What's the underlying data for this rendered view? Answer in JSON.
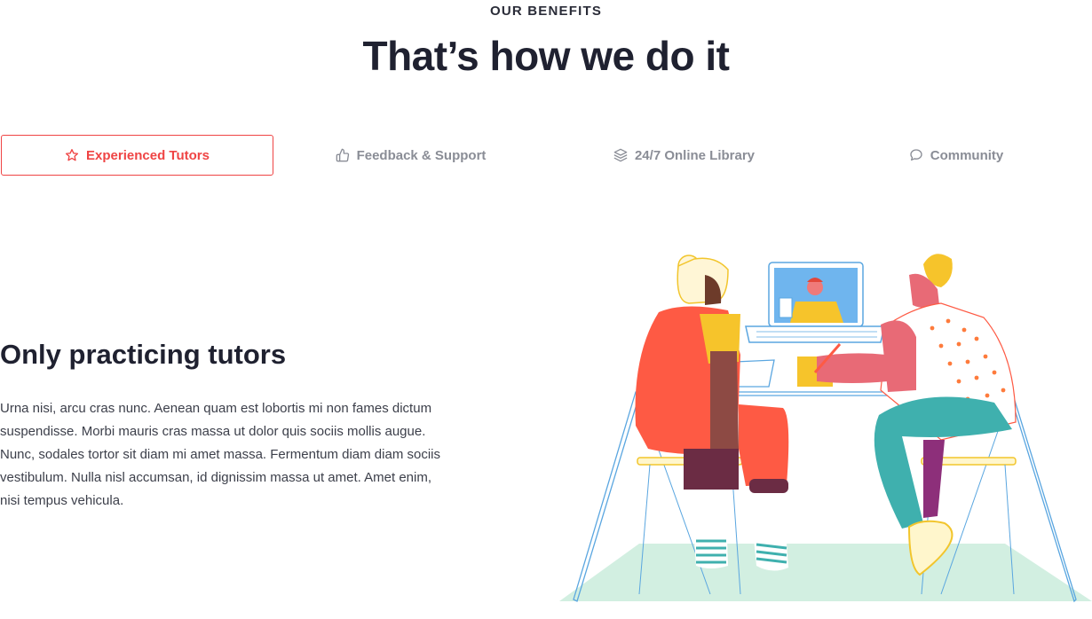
{
  "section": {
    "eyebrow": "OUR BENEFITS",
    "title": "That’s how we do it"
  },
  "tabs": [
    {
      "label": "Experienced Tutors",
      "icon": "star-icon",
      "active": true
    },
    {
      "label": "Feedback & Support",
      "icon": "thumbs-up-icon",
      "active": false
    },
    {
      "label": "24/7 Online Library",
      "icon": "layers-icon",
      "active": false
    },
    {
      "label": "Community",
      "icon": "chat-bubble-icon",
      "active": false
    }
  ],
  "content": {
    "title": "Only practicing tutors",
    "body": "Urna nisi, arcu cras nunc. Aenean quam est lobortis mi non fames dictum suspendisse. Morbi mauris cras massa ut dolor quis sociis mollis augue. Nunc, sodales tortor sit diam mi amet massa. Fermentum diam diam sociis vestibulum. Nulla nisl accumsan, id dignissim massa ut amet. Amet enim, nisi tempus vehicula."
  },
  "colors": {
    "accent": "#ef4444",
    "muted_tab": "#8a8d96",
    "heading": "#1f2130"
  }
}
